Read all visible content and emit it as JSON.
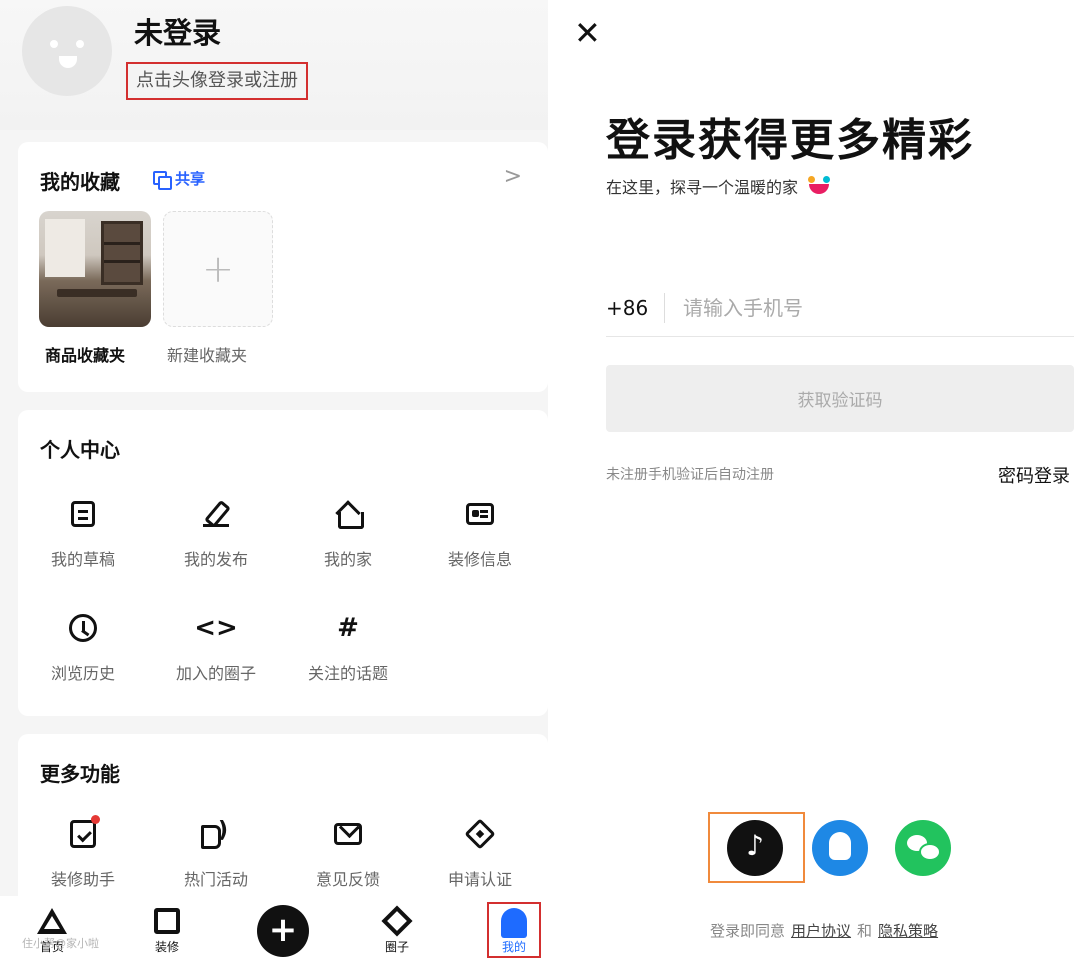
{
  "left": {
    "profile": {
      "name": "未登录",
      "hint": "点击头像登录或注册"
    },
    "favorites": {
      "title": "我的收藏",
      "share_label": "共享",
      "chevron": ">",
      "folders": [
        {
          "label": "商品收藏夹"
        },
        {
          "label": "新建收藏夹"
        }
      ],
      "add_symbol": "+"
    },
    "personal_center": {
      "title": "个人中心",
      "items": [
        {
          "label": "我的草稿",
          "icon": "draft-icon"
        },
        {
          "label": "我的发布",
          "icon": "pen-icon"
        },
        {
          "label": "我的家",
          "icon": "home-icon"
        },
        {
          "label": "装修信息",
          "icon": "id-card-icon"
        },
        {
          "label": "浏览历史",
          "icon": "clock-icon"
        },
        {
          "label": "加入的圈子",
          "icon": "code-brackets-icon",
          "glyph": "<>"
        },
        {
          "label": "关注的话题",
          "icon": "hashtag-icon",
          "glyph": "#"
        }
      ]
    },
    "more_features": {
      "title": "更多功能",
      "items": [
        {
          "label": "装修助手",
          "icon": "clipboard-check-icon"
        },
        {
          "label": "热门活动",
          "icon": "speaker-icon"
        },
        {
          "label": "意见反馈",
          "icon": "mail-icon"
        },
        {
          "label": "申请认证",
          "icon": "badge-icon"
        }
      ]
    },
    "tabbar": {
      "items": [
        {
          "label": "首页",
          "icon": "triangle-icon"
        },
        {
          "label": "装修",
          "icon": "square-icon"
        },
        {
          "label": "",
          "icon": "plus-icon",
          "glyph": "+"
        },
        {
          "label": "圈子",
          "icon": "diamond-icon"
        },
        {
          "label": "我的",
          "icon": "person-icon"
        }
      ]
    },
    "watermark": "住小帮@家小啦"
  },
  "right": {
    "close_symbol": "✕",
    "headline": "登录获得更多精彩",
    "subline": "在这里，探寻一个温暖的家",
    "phone": {
      "country_code": "+86",
      "placeholder": "请输入手机号"
    },
    "get_code_button": "获取验证码",
    "auto_register_note": "未注册手机验证后自动注册",
    "password_login": "密码登录",
    "agreement": {
      "prefix": "登录即同意",
      "user_agreement": "用户协议",
      "and": "和",
      "privacy_policy": "隐私策略"
    }
  },
  "colors": {
    "accent_blue": "#1e6bff",
    "highlight_red": "#d32f2f",
    "highlight_orange": "#f08a3c",
    "qq_blue": "#1e88e5",
    "wechat_green": "#22c35e"
  }
}
